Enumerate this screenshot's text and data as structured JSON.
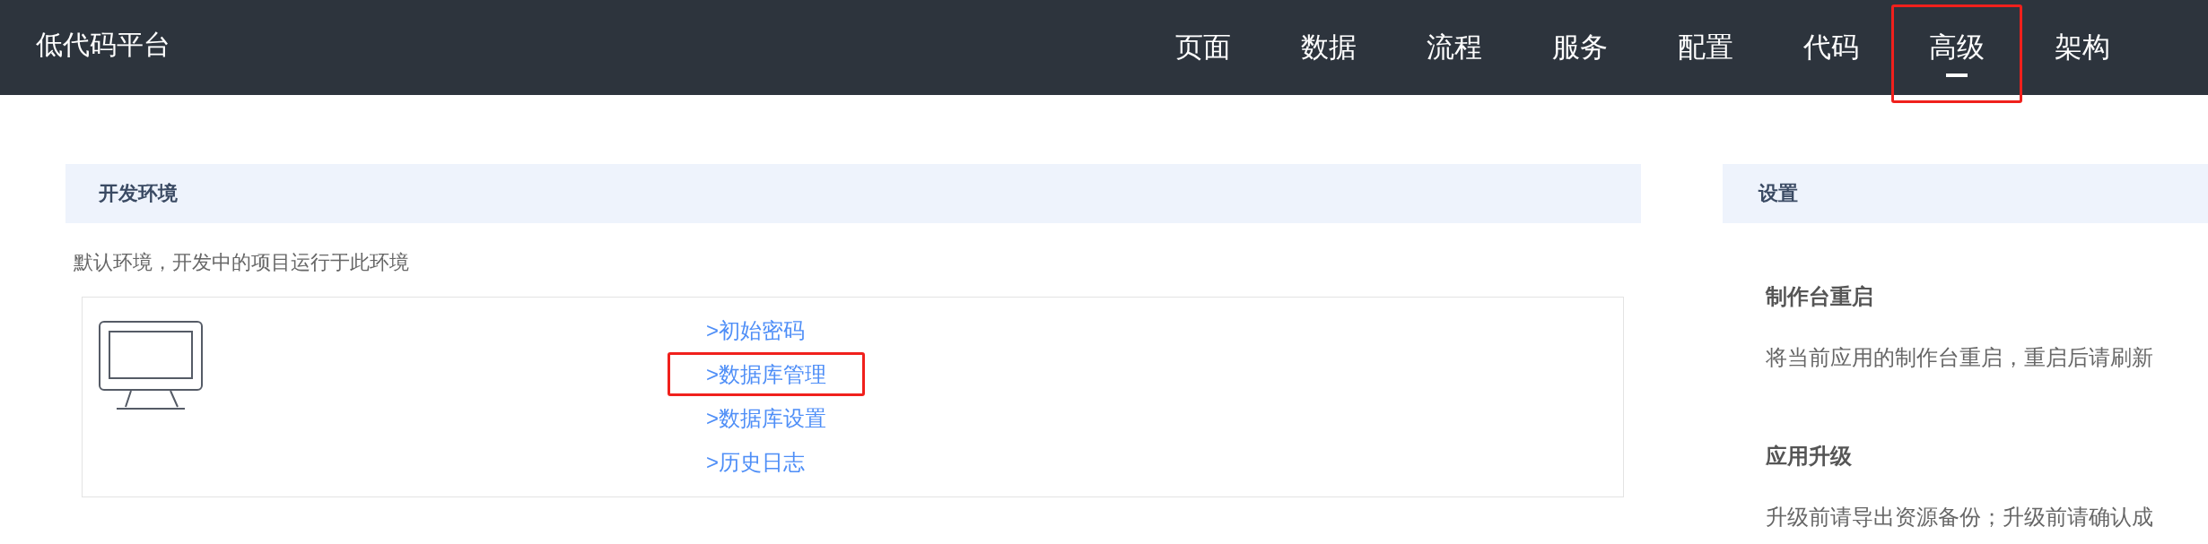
{
  "header": {
    "brand": "低代码平台",
    "nav": [
      {
        "label": "页面",
        "selected": false,
        "highlighted": false
      },
      {
        "label": "数据",
        "selected": false,
        "highlighted": false
      },
      {
        "label": "流程",
        "selected": false,
        "highlighted": false
      },
      {
        "label": "服务",
        "selected": false,
        "highlighted": false
      },
      {
        "label": "配置",
        "selected": false,
        "highlighted": false
      },
      {
        "label": "代码",
        "selected": false,
        "highlighted": false
      },
      {
        "label": "高级",
        "selected": true,
        "highlighted": true
      },
      {
        "label": "架构",
        "selected": false,
        "highlighted": false
      }
    ]
  },
  "dev_env": {
    "title": "开发环境",
    "description": "默认环境，开发中的项目运行于此环境",
    "links": [
      {
        "label": ">初始密码",
        "highlighted": false
      },
      {
        "label": ">数据库管理",
        "highlighted": true
      },
      {
        "label": ">数据库设置",
        "highlighted": false
      },
      {
        "label": ">历史日志",
        "highlighted": false
      }
    ]
  },
  "settings": {
    "title": "设置",
    "items": [
      {
        "title": "制作台重启",
        "description": "将当前应用的制作台重启，重启后请刷新"
      },
      {
        "title": "应用升级",
        "description": "升级前请导出资源备份；升级前请确认成"
      }
    ]
  }
}
